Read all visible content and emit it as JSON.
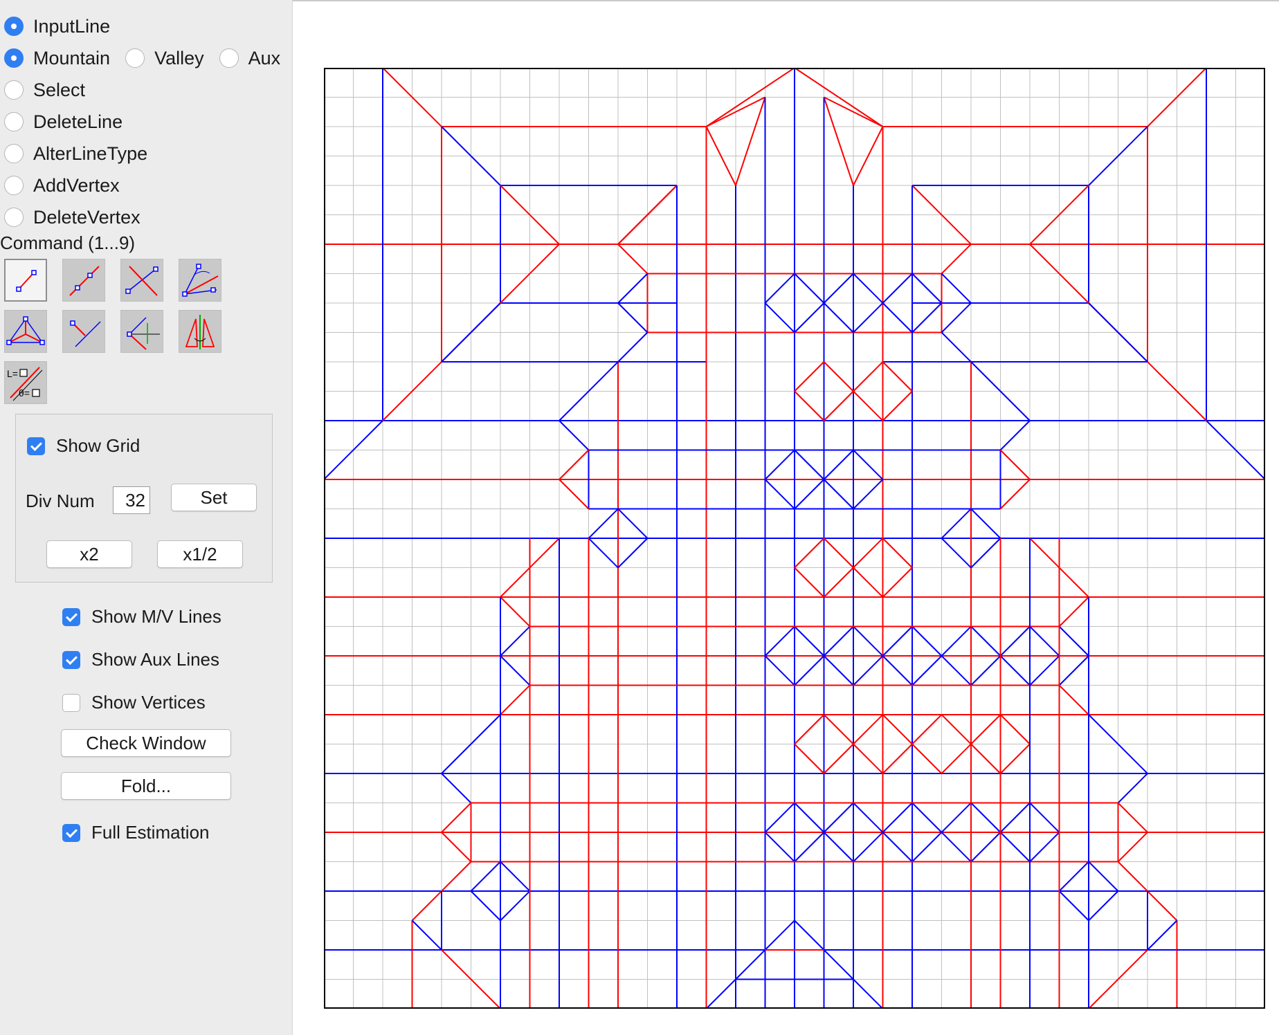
{
  "modes": [
    {
      "label": "InputLine",
      "selected": true
    },
    {
      "label": "Select",
      "selected": false
    },
    {
      "label": "DeleteLine",
      "selected": false
    },
    {
      "label": "AlterLineType",
      "selected": false
    },
    {
      "label": "AddVertex",
      "selected": false
    },
    {
      "label": "DeleteVertex",
      "selected": false
    }
  ],
  "line_types": [
    {
      "label": "Mountain",
      "selected": true
    },
    {
      "label": "Valley",
      "selected": false
    },
    {
      "label": "Aux",
      "selected": false
    }
  ],
  "command_title": "Command (1...9)",
  "commands": [
    {
      "icon": "two-point-line-icon",
      "selected": true
    },
    {
      "icon": "point-to-line-icon",
      "selected": false
    },
    {
      "icon": "perpendicular-bisector-icon",
      "selected": false
    },
    {
      "icon": "angle-bisector-icon",
      "selected": false
    },
    {
      "icon": "triangle-incenter-icon",
      "selected": false
    },
    {
      "icon": "perpendicular-line-icon",
      "selected": false
    },
    {
      "icon": "symmetric-line-icon",
      "selected": false
    },
    {
      "icon": "mirror-copy-icon",
      "selected": false
    },
    {
      "icon": "length-angle-input-icon",
      "selected": false
    }
  ],
  "grid_panel": {
    "show_grid_label": "Show Grid",
    "show_grid": true,
    "div_num_label": "Div Num",
    "div_num_value": "32",
    "set_label": "Set",
    "double_label": "x2",
    "half_label": "x1/2"
  },
  "options": {
    "show_mv_label": "Show M/V Lines",
    "show_mv": true,
    "show_aux_label": "Show Aux Lines",
    "show_aux": true,
    "show_vertices_label": "Show Vertices",
    "show_vertices": false,
    "check_window_label": "Check Window",
    "fold_label": "Fold...",
    "full_estimation_label": "Full Estimation",
    "full_estimation": true
  },
  "colors": {
    "mountain": "#ff0000",
    "valley": "#0000ff",
    "grid": "#c0c0c0",
    "border": "#000000",
    "accent": "#2f7ff2"
  },
  "crease_pattern": {
    "divisions": 32,
    "grid_visible": true
  }
}
